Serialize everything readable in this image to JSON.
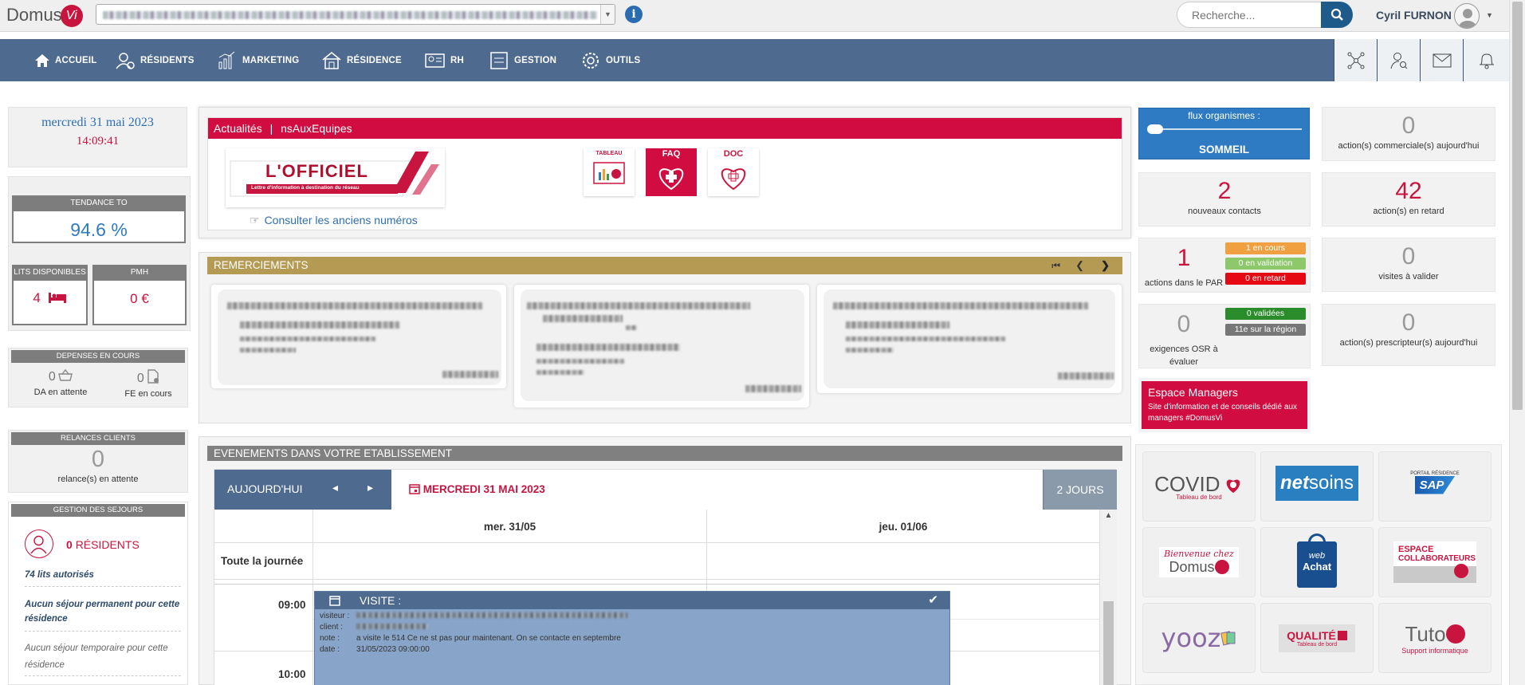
{
  "header": {
    "logo_text": "Domus",
    "logo_badge": "Vi",
    "search_placeholder": "Recherche...",
    "user_name": "Cyril FURNON"
  },
  "nav": {
    "items": [
      {
        "label": "ACCUEIL",
        "icon": "home-icon"
      },
      {
        "label": "RÉSIDENTS",
        "icon": "residents-icon"
      },
      {
        "label": "MARKETING",
        "icon": "chart-icon"
      },
      {
        "label": "RÉSIDENCE",
        "icon": "building-icon"
      },
      {
        "label": "RH",
        "icon": "id-card-icon"
      },
      {
        "label": "GESTION",
        "icon": "clipboard-icon"
      },
      {
        "label": "OUTILS",
        "icon": "gear-icon"
      }
    ],
    "right_icons": [
      "network-icon",
      "user-search-icon",
      "mail-icon",
      "bell-icon"
    ]
  },
  "datetime": {
    "date": "mercredi 31 mai 2023",
    "time": "14:09:41"
  },
  "tendance": {
    "label": "TENDANCE TO",
    "value": "94.6 %"
  },
  "lits": {
    "label": "LITS DISPONIBLES",
    "value": "4"
  },
  "pmh": {
    "label": "PMH",
    "value": "0 €"
  },
  "depenses": {
    "title": "DEPENSES EN COURS",
    "da_value": "0",
    "da_label": "DA en attente",
    "fe_value": "0",
    "fe_label": "FE en cours"
  },
  "relances": {
    "title": "RELANCES CLIENTS",
    "value": "0",
    "label": "relance(s) en attente"
  },
  "sejours": {
    "title": "GESTION DES SEJOURS",
    "residents_count": "0",
    "residents_label": "RÉSIDENTS",
    "lits": "74 lits autorisés",
    "permanent": "Aucun séjour permanent pour cette résidence",
    "temporaire": "Aucun séjour temporaire pour cette résidence"
  },
  "actualites": {
    "tab1": "Actualités",
    "sep": "|",
    "tab2": "nsAuxEquipes",
    "officiel": "L'OFFICIEL",
    "officiel_sub": "Lettre d'information à destination du réseau",
    "consulter": "Consulter les anciens numéros",
    "tile1": "TABLEAU",
    "tile2": "FAQ",
    "tile3": "DOC"
  },
  "remerciements": {
    "title": "REMERCIEMENTS"
  },
  "evenements": {
    "title": "EVENEMENTS DANS VOTRE ETABLISSEMENT",
    "today_btn": "AUJOURD'HUI",
    "prev": "◂",
    "next": "▸",
    "current_date": "MERCREDI 31 MAI 2023",
    "view_btn": "2 JOURS",
    "col1": "mer. 31/05",
    "col2": "jeu. 01/06",
    "allday": "Toute la journée",
    "hour1": "09:00",
    "hour2": "10:00",
    "event": {
      "title": "VISITE :",
      "visiteur_lbl": "visiteur :",
      "client_lbl": "client :",
      "note_lbl": "note :",
      "note": "a visite le 514 Ce ne st pas pour maintenant. On se contacte en septembre",
      "date_lbl": "date :",
      "date": "31/05/2023 09:00:00"
    }
  },
  "flux": {
    "title": "flux organismes :",
    "status": "SOMMEIL"
  },
  "stats": {
    "commerciales": {
      "value": "0",
      "label": "action(s) commerciale(s) aujourd'hui"
    },
    "contacts": {
      "value": "2",
      "label": "nouveaux contacts"
    },
    "retard": {
      "value": "42",
      "label": "action(s) en retard"
    },
    "par": {
      "value": "1",
      "label": "actions dans le PAR",
      "b1": "1 en cours",
      "b2": "0 en validation",
      "b3": "0 en retard"
    },
    "visites": {
      "value": "0",
      "label": "visites à valider"
    },
    "osr": {
      "value": "0",
      "label": "exigences OSR à évaluer",
      "b1": "0 validées",
      "b2": "11e sur la région"
    },
    "prescripteur": {
      "value": "0",
      "label": "action(s) prescripteur(s) aujourd'hui"
    }
  },
  "espace": {
    "title": "Espace Managers",
    "desc": "Site d'information et de conseils dédié aux managers #DomusVi"
  },
  "tiles": {
    "covid": "COVID",
    "covid_sub": "Tableau de bord",
    "netsoins_a": "net",
    "netsoins_b": "soins",
    "sap": "SAP",
    "sap_top": "PORTAIL RÉSIDENCE",
    "bienvenue": "Bienvenue chez",
    "bienvenue_b": "Domus",
    "webachat_a": "web",
    "webachat_b": "Achat",
    "collab_a": "ESPACE",
    "collab_b": "COLLABORATEURS",
    "yooz": "yooz",
    "qualite": "QUALITÉ",
    "qualite_sub": "Tableau de bord",
    "tuto": "Tuto",
    "tuto_sub": "Support informatique"
  },
  "colors": {
    "nav": "#4e6b8f",
    "brand": "#c8153f",
    "gold": "#b59a54",
    "blue": "#2e7bc4"
  }
}
